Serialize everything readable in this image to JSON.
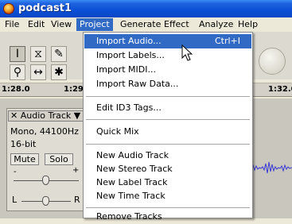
{
  "window": {
    "title": "podcast1"
  },
  "menubar": {
    "items": [
      {
        "label": "File"
      },
      {
        "label": "Edit"
      },
      {
        "label": "View"
      },
      {
        "label": "Project"
      },
      {
        "label": "Generate"
      },
      {
        "label": "Effect"
      },
      {
        "label": "Analyze"
      },
      {
        "label": "Help"
      }
    ],
    "active_index": 3
  },
  "toolbar": {
    "tools": [
      {
        "icon": "selection-tool-icon",
        "glyph": "I"
      },
      {
        "icon": "envelope-tool-icon",
        "glyph": "⧖"
      },
      {
        "icon": "draw-tool-icon",
        "glyph": "✎"
      },
      {
        "icon": "zoom-tool-icon",
        "glyph": "⚲"
      },
      {
        "icon": "timeshift-tool-icon",
        "glyph": "↔"
      },
      {
        "icon": "multi-tool-icon",
        "glyph": "✱"
      }
    ]
  },
  "ruler": {
    "labels": [
      "1:28.0",
      "1:29",
      "1:32.0"
    ]
  },
  "track": {
    "name": "Audio Track",
    "close_glyph": "✕",
    "dropdown_glyph": "▼",
    "info_rate": "Mono, 44100Hz",
    "info_bits": "16-bit",
    "mute_label": "Mute",
    "solo_label": "Solo",
    "gain_minus": "-",
    "gain_plus": "+",
    "pan_left": "L",
    "pan_right": "R"
  },
  "project_menu": {
    "groups": [
      [
        {
          "label": "Import Audio...",
          "shortcut": "Ctrl+I"
        },
        {
          "label": "Import Labels..."
        },
        {
          "label": "Import MIDI..."
        },
        {
          "label": "Import Raw Data..."
        }
      ],
      [
        {
          "label": "Edit ID3 Tags..."
        }
      ],
      [
        {
          "label": "Quick Mix"
        }
      ],
      [
        {
          "label": "New Audio Track"
        },
        {
          "label": "New Stereo Track"
        },
        {
          "label": "New Label Track"
        },
        {
          "label": "New Time Track"
        }
      ],
      [
        {
          "label": "Remove Tracks"
        }
      ]
    ],
    "highlighted": "Import Audio..."
  },
  "colors": {
    "titlebar": "#0a4fd6",
    "menu_highlight": "#316ac5",
    "waveform": "#3a3ad6"
  }
}
